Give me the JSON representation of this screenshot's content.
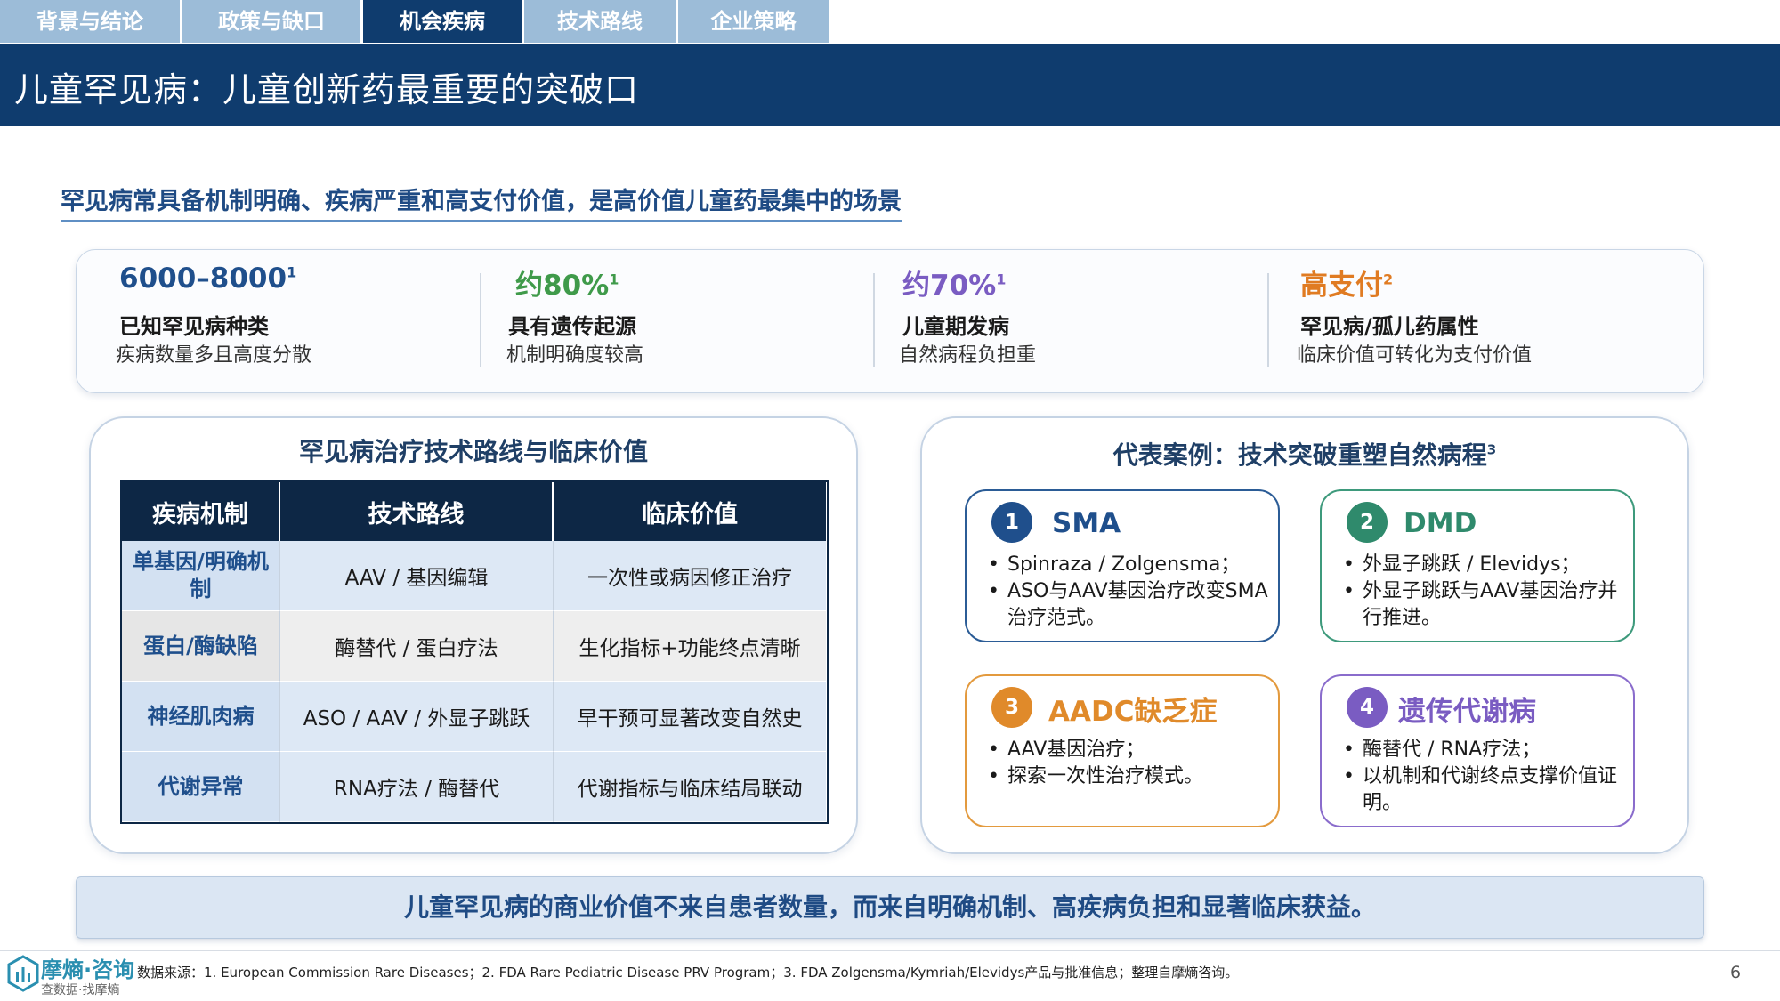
{
  "nav": {
    "tabs": [
      {
        "label": "背景与结论",
        "active": false
      },
      {
        "label": "政策与缺口",
        "active": false
      },
      {
        "label": "机会疾病",
        "active": true
      },
      {
        "label": "技术路线",
        "active": false
      },
      {
        "label": "企业策略",
        "active": false
      }
    ]
  },
  "page_title": "儿童罕见病：儿童创新药最重要的突破口",
  "subtitle": "罕见病常具备机制明确、疾病严重和高支付价值，是高价值儿童药最集中的场景",
  "stats": [
    {
      "value": "6000–8000",
      "sup": "1",
      "label": "已知罕见病种类",
      "desc": "疾病数量多且高度分散",
      "color": "#1f4f8c"
    },
    {
      "value": "约80%",
      "sup": "1",
      "label": "具有遗传起源",
      "desc": "机制明确度较高",
      "color": "#3f9a4a"
    },
    {
      "value": "约70%",
      "sup": "1",
      "label": "儿童期发病",
      "desc": "自然病程负担重",
      "color": "#7a5cc2"
    },
    {
      "value": "高支付",
      "sup": "2",
      "label": "罕见病/孤儿药属性",
      "desc": "临床价值可转化为支付价值",
      "color": "#e07b22"
    }
  ],
  "left_panel": {
    "title": "罕见病治疗技术路线与临床价值",
    "table": {
      "headers": [
        "疾病机制",
        "技术路线",
        "临床价值"
      ],
      "rows": [
        [
          "单基因/明确机制",
          "AAV / 基因编辑",
          "一次性或病因修正治疗"
        ],
        [
          "蛋白/酶缺陷",
          "酶替代 / 蛋白疗法",
          "生化指标+功能终点清晰"
        ],
        [
          "神经肌肉病",
          "ASO / AAV / 外显子跳跃",
          "早干预可显著改变自然史"
        ],
        [
          "代谢异常",
          "RNA疗法 / 酶替代",
          "代谢指标与临床结局联动"
        ]
      ]
    }
  },
  "right_panel": {
    "title": "代表案例：技术突破重塑自然病程",
    "title_sup": "3",
    "cases": [
      {
        "num": "1",
        "title": "SMA",
        "color": "#1f4f8c",
        "bullets": [
          "Spinraza / Zolgensma；",
          "ASO与AAV基因治疗改变SMA治疗范式。"
        ]
      },
      {
        "num": "2",
        "title": "DMD",
        "color": "#2f8a6c",
        "bullets": [
          "外显子跳跃 / Elevidys；",
          "外显子跳跃与AAV基因治疗并行推进。"
        ]
      },
      {
        "num": "3",
        "title": "AADC缺乏症",
        "color": "#e08a2a",
        "bullets": [
          "AAV基因治疗；",
          "探索一次性治疗模式。"
        ]
      },
      {
        "num": "4",
        "title": "遗传代谢病",
        "color": "#7a5cc2",
        "bullets": [
          "酶替代 / RNA疗法；",
          "以机制和代谢终点支撑价值证明。"
        ]
      }
    ]
  },
  "conclusion": "儿童罕见病的商业价值不来自患者数量，而来自明确机制、高疾病负担和显著临床获益。",
  "footer": {
    "logo_name": "摩熵·咨询",
    "logo_tag": "查数据·找摩熵",
    "source": "数据来源：1. European Commission Rare Diseases；2. FDA Rare Pediatric Disease PRV Program；3. FDA Zolgensma/Kymriah/Elevidys产品与批准信息；整理自摩熵咨询。",
    "page_number": "6"
  }
}
